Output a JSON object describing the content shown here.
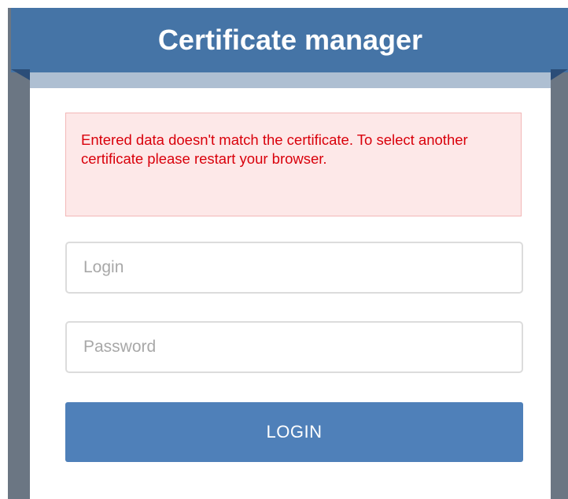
{
  "header": {
    "title": "Certificate manager"
  },
  "alert": {
    "message": "Entered data doesn't match the certificate. To select another certificate please restart your browser."
  },
  "form": {
    "login_placeholder": "Login",
    "login_value": "",
    "password_placeholder": "Password",
    "password_value": "",
    "submit_label": "LOGIN"
  },
  "colors": {
    "header_bg": "#4574a6",
    "button_bg": "#4f80b9",
    "alert_text": "#d9000b",
    "alert_bg": "#fde8e8"
  }
}
